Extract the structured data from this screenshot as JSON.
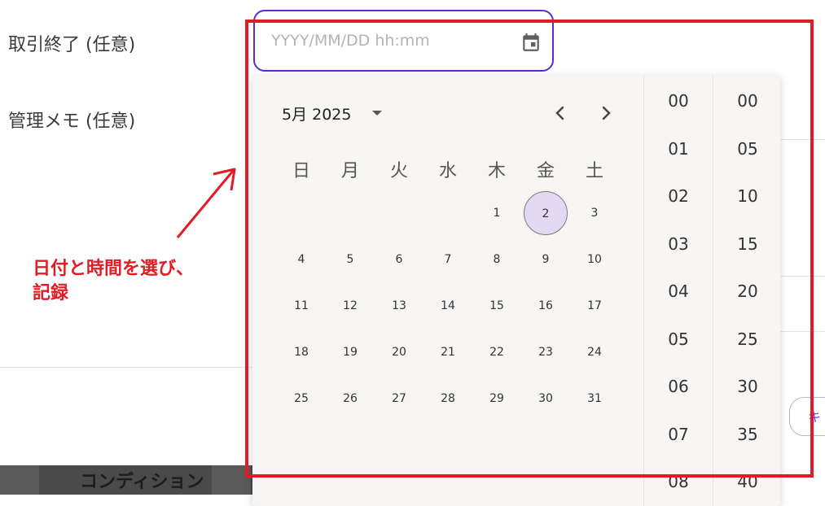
{
  "form": {
    "end_label": "取引終了 (任意)",
    "memo_label": "管理メモ (任意)",
    "date_placeholder": "YYYY/MM/DD hh:mm"
  },
  "footer": {
    "condition_label": "コンディション",
    "partial_button_label": "キ"
  },
  "calendar": {
    "month_label": "5月 2025",
    "weekdays": [
      "日",
      "月",
      "火",
      "水",
      "木",
      "金",
      "土"
    ],
    "weeks": [
      [
        "",
        "",
        "",
        "",
        "1",
        "2",
        "3"
      ],
      [
        "4",
        "5",
        "6",
        "7",
        "8",
        "9",
        "10"
      ],
      [
        "11",
        "12",
        "13",
        "14",
        "15",
        "16",
        "17"
      ],
      [
        "18",
        "19",
        "20",
        "21",
        "22",
        "23",
        "24"
      ],
      [
        "25",
        "26",
        "27",
        "28",
        "29",
        "30",
        "31"
      ]
    ],
    "selected_day": "2"
  },
  "time": {
    "hours": [
      "00",
      "01",
      "02",
      "03",
      "04",
      "05",
      "06",
      "07",
      "08"
    ],
    "minutes": [
      "00",
      "05",
      "10",
      "15",
      "20",
      "25",
      "30",
      "35",
      "40"
    ]
  },
  "annotation": {
    "line1": "日付と時間を選び、",
    "line2": "記録",
    "color": "#e11c24"
  },
  "colors": {
    "accent": "#5a2bd0",
    "selected_bg": "#e3d9f2",
    "popup_bg": "#f7f6f4"
  },
  "icons": {
    "calendar": "calendar-icon",
    "dropdown": "dropdown-icon",
    "prev": "chevron-left-icon",
    "next": "chevron-right-icon"
  }
}
